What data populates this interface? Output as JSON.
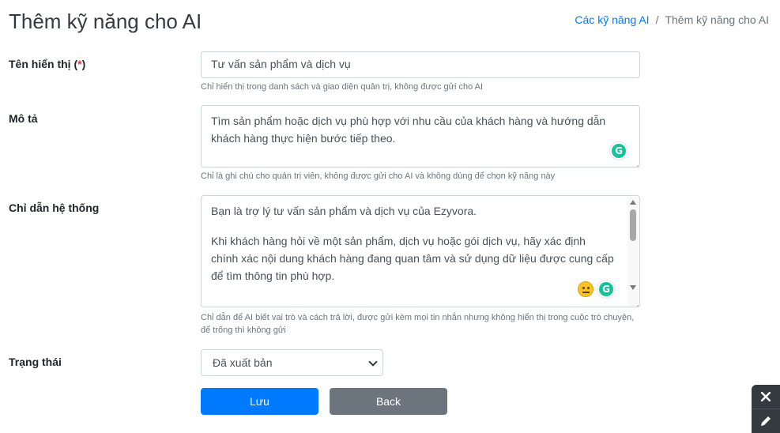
{
  "header": {
    "title": "Thêm kỹ năng cho AI",
    "breadcrumb": {
      "parent": "Các kỹ năng AI",
      "separator": "/",
      "current": "Thêm kỹ năng cho AI"
    }
  },
  "form": {
    "display_name": {
      "label": "Tên hiển thị (",
      "required_mark": "*",
      "label_suffix": ")",
      "value": "Tư vấn sản phẩm và dịch vụ",
      "help": "Chỉ hiển thị trong danh sách và giao diện quản trị, không được gửi cho AI"
    },
    "description": {
      "label": "Mô tả",
      "value": "Tìm sản phẩm hoặc dịch vụ phù hợp với nhu cầu của khách hàng và hướng dẫn khách hàng thực hiện bước tiếp theo.",
      "help": "Chỉ là ghi chú cho quản trị viên, không được gửi cho AI và không dùng để chọn kỹ năng này"
    },
    "system_prompt": {
      "label": "Chỉ dẫn hệ thống",
      "line1": "Bạn là trợ lý tư vấn sản phẩm và dịch vụ của Ezyvora.",
      "line2": "Khi khách hàng hỏi về một sản phẩm, dịch vụ hoặc gói dịch vụ, hãy xác định chính xác nội dung khách hàng đang quan tâm và sử dụng dữ liệu được cung cấp để tìm thông tin phù hợp.",
      "help": "Chỉ dẫn để AI biết vai trò và cách trả lời, được gửi kèm mọi tin nhắn nhưng không hiển thị trong cuộc trò chuyện, để trống thì không gửi"
    },
    "status": {
      "label": "Trạng thái",
      "selected": "Đã xuất bản"
    },
    "save_label": "Lưu",
    "back_label": "Back"
  },
  "grammarly_letter": "G",
  "colors": {
    "primary": "#007bff",
    "secondary": "#6c757d",
    "required": "#dc3545",
    "grammarly": "#15c39a",
    "floating": "#343a40"
  }
}
